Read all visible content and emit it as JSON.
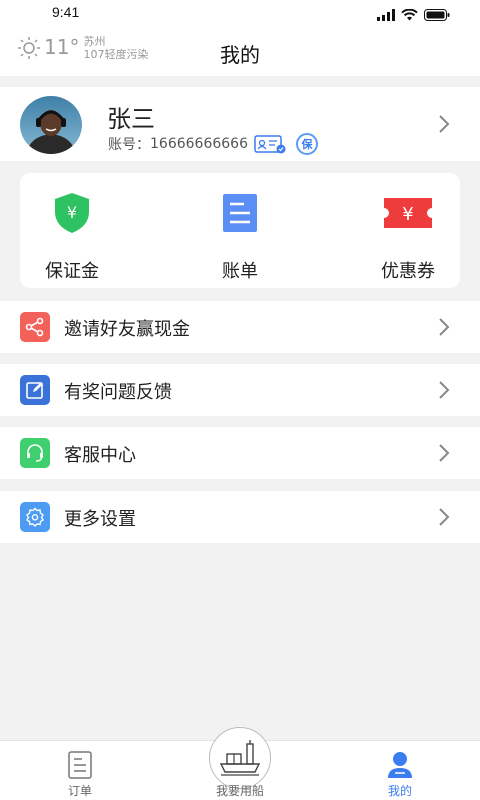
{
  "status_bar": {
    "time": "9:41"
  },
  "header": {
    "weather": {
      "temp": "11°",
      "city": "苏州",
      "aqi": "107轻度污染",
      "icon": "sun-icon"
    },
    "title": "我的"
  },
  "profile": {
    "name": "张三",
    "account_label": "账号：",
    "account_value": "16666666666",
    "badges": [
      "id-card-verified-icon",
      "insurance-badge-icon"
    ],
    "insurance_char": "保"
  },
  "quick_actions": [
    {
      "label": "保证金",
      "icon": "deposit-shield-icon",
      "symbol": "¥"
    },
    {
      "label": "账单",
      "icon": "bill-icon"
    },
    {
      "label": "优惠券",
      "icon": "coupon-icon",
      "symbol": "¥"
    }
  ],
  "menu": [
    {
      "label": "邀请好友赢现金",
      "icon": "share-icon",
      "color": "#f2625b"
    },
    {
      "label": "有奖问题反馈",
      "icon": "edit-icon",
      "color": "#3a72d8"
    },
    {
      "label": "客服中心",
      "icon": "headset-icon",
      "color": "#3fcf6f"
    },
    {
      "label": "更多设置",
      "icon": "settings-icon",
      "color": "#4d9bf2"
    }
  ],
  "tab_bar": {
    "tabs": [
      {
        "label": "订单",
        "icon": "order-icon"
      },
      {
        "label": "我要用船",
        "icon": "ship-icon"
      },
      {
        "label": "我的",
        "icon": "user-icon"
      }
    ],
    "active_index": 2,
    "active_color": "#3b7cf0"
  }
}
